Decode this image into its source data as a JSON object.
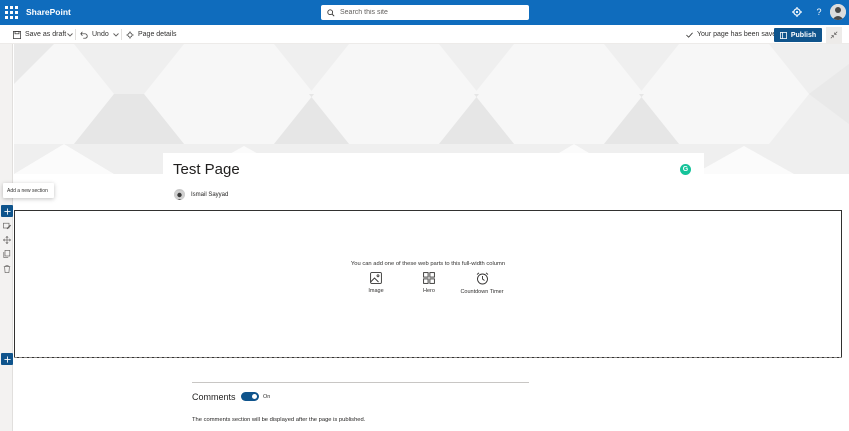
{
  "suite_bar": {
    "app_name": "SharePoint",
    "search_placeholder": "Search this site",
    "icons": [
      "waffle-icon",
      "search-icon",
      "gear-icon",
      "help-icon",
      "avatar"
    ],
    "help_label": "?"
  },
  "command_bar": {
    "save_as_draft": "Save as draft",
    "undo": "Undo",
    "page_details": "Page details",
    "saved_status": "Your page has been saved",
    "publish": "Publish"
  },
  "left_rail": {
    "tooltip": "Add a new section"
  },
  "page": {
    "title": "Test Page",
    "author": "Ismail Sayyad",
    "grammarly_label": "G"
  },
  "section": {
    "hint": "You can add one of these web parts to this full-width column",
    "web_parts": [
      {
        "label": "Image",
        "icon": "image-icon"
      },
      {
        "label": "Hero",
        "icon": "hero-icon"
      },
      {
        "label": "Countdown Timer",
        "icon": "timer-icon"
      }
    ]
  },
  "comments": {
    "title": "Comments",
    "toggle_label": "On",
    "toggle_on": true,
    "note": "The comments section will be displayed after the page is published."
  },
  "colors": {
    "suite_bar": "#0f6cbd",
    "accent": "#0f548c",
    "grammarly": "#15c39a"
  }
}
